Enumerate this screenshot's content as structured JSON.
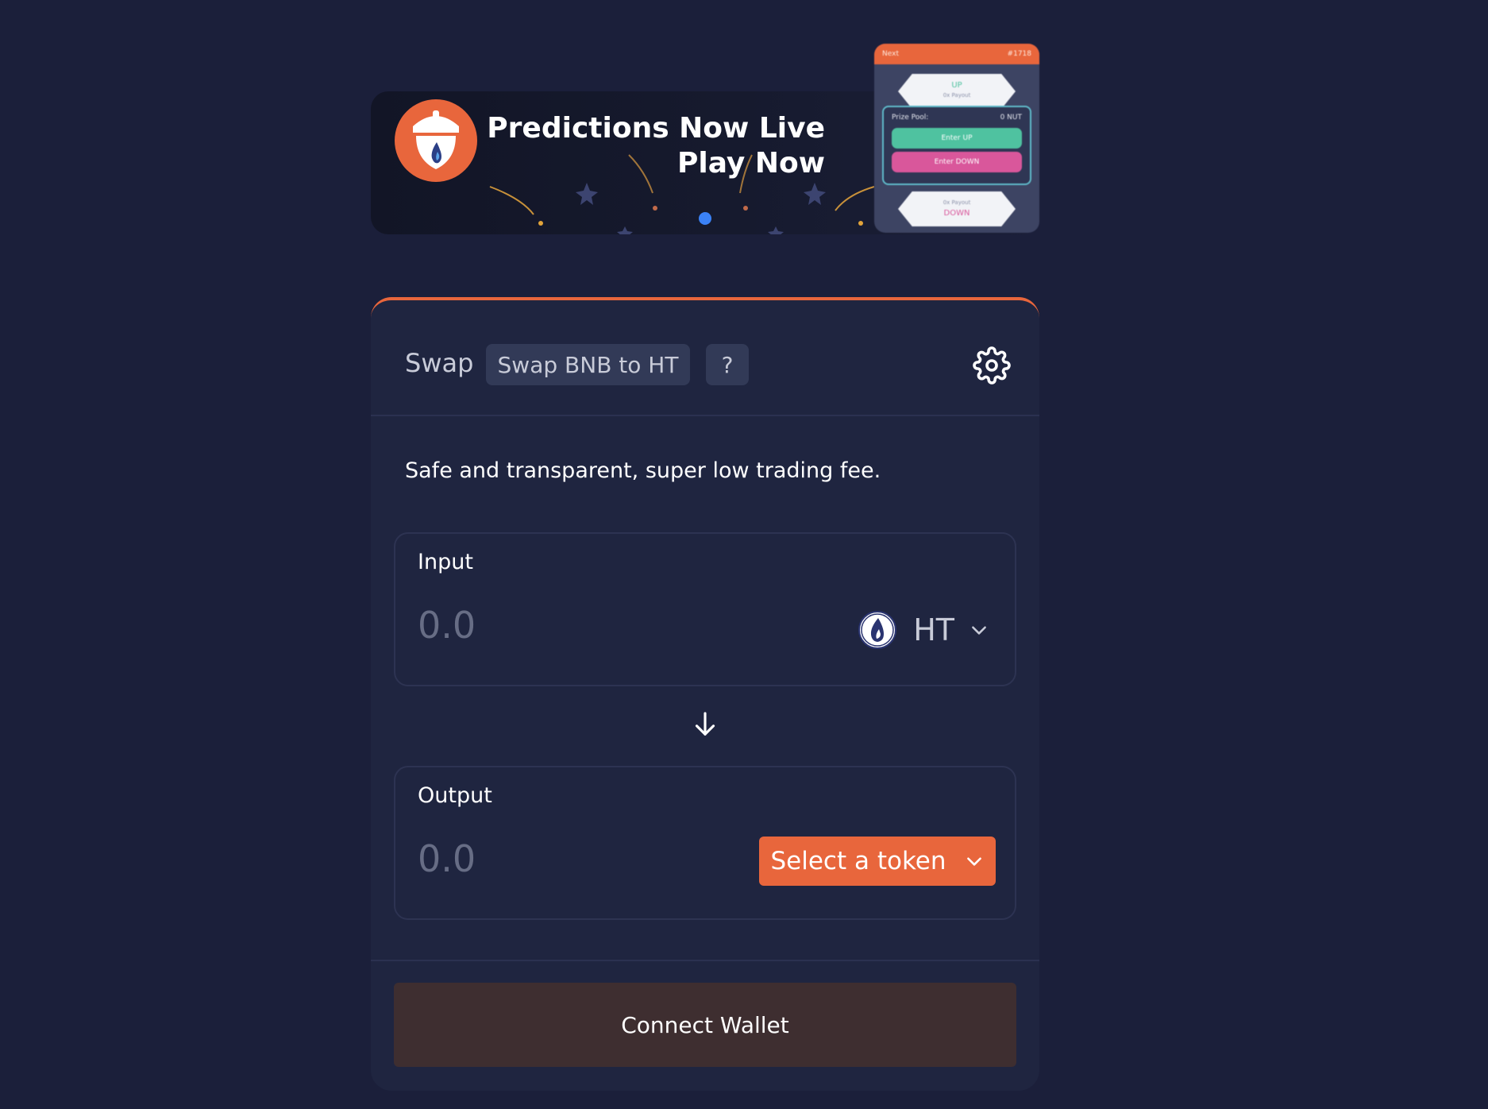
{
  "banner": {
    "title_line1": "Predictions Now Live",
    "title_line2": "Play Now",
    "phone": {
      "header_left": "Next",
      "header_right": "#1718",
      "up_label": "UP",
      "up_payout": "0x Payout",
      "prize_pool_label": "Prize Pool:",
      "prize_pool_value": "0 NUT",
      "enter_up": "Enter UP",
      "enter_down": "Enter DOWN",
      "down_payout": "0x Payout",
      "down_label": "DOWN"
    }
  },
  "swap": {
    "title": "Swap",
    "chip_label": "Swap BNB to HT",
    "help_label": "?",
    "tagline": "Safe and transparent, super low trading fee.",
    "input": {
      "label": "Input",
      "placeholder": "0.0",
      "token": "HT"
    },
    "output": {
      "label": "Output",
      "placeholder": "0.0",
      "select_label": "Select a token"
    },
    "connect_label": "Connect Wallet"
  },
  "colors": {
    "background": "#1b1f3a",
    "card": "#1f2540",
    "accent": "#e8663c",
    "connect_button": "#3e2e30",
    "carousel_dot": "#3b82f6",
    "enter_up": "#4fc2a0",
    "enter_down": "#d9579b"
  },
  "icons": {
    "logo": "acorn-flame-logo",
    "settings": "gear-icon",
    "token": "ht-flame-icon",
    "dropdown": "chevron-down-icon",
    "swap_direction": "arrow-down-icon"
  }
}
